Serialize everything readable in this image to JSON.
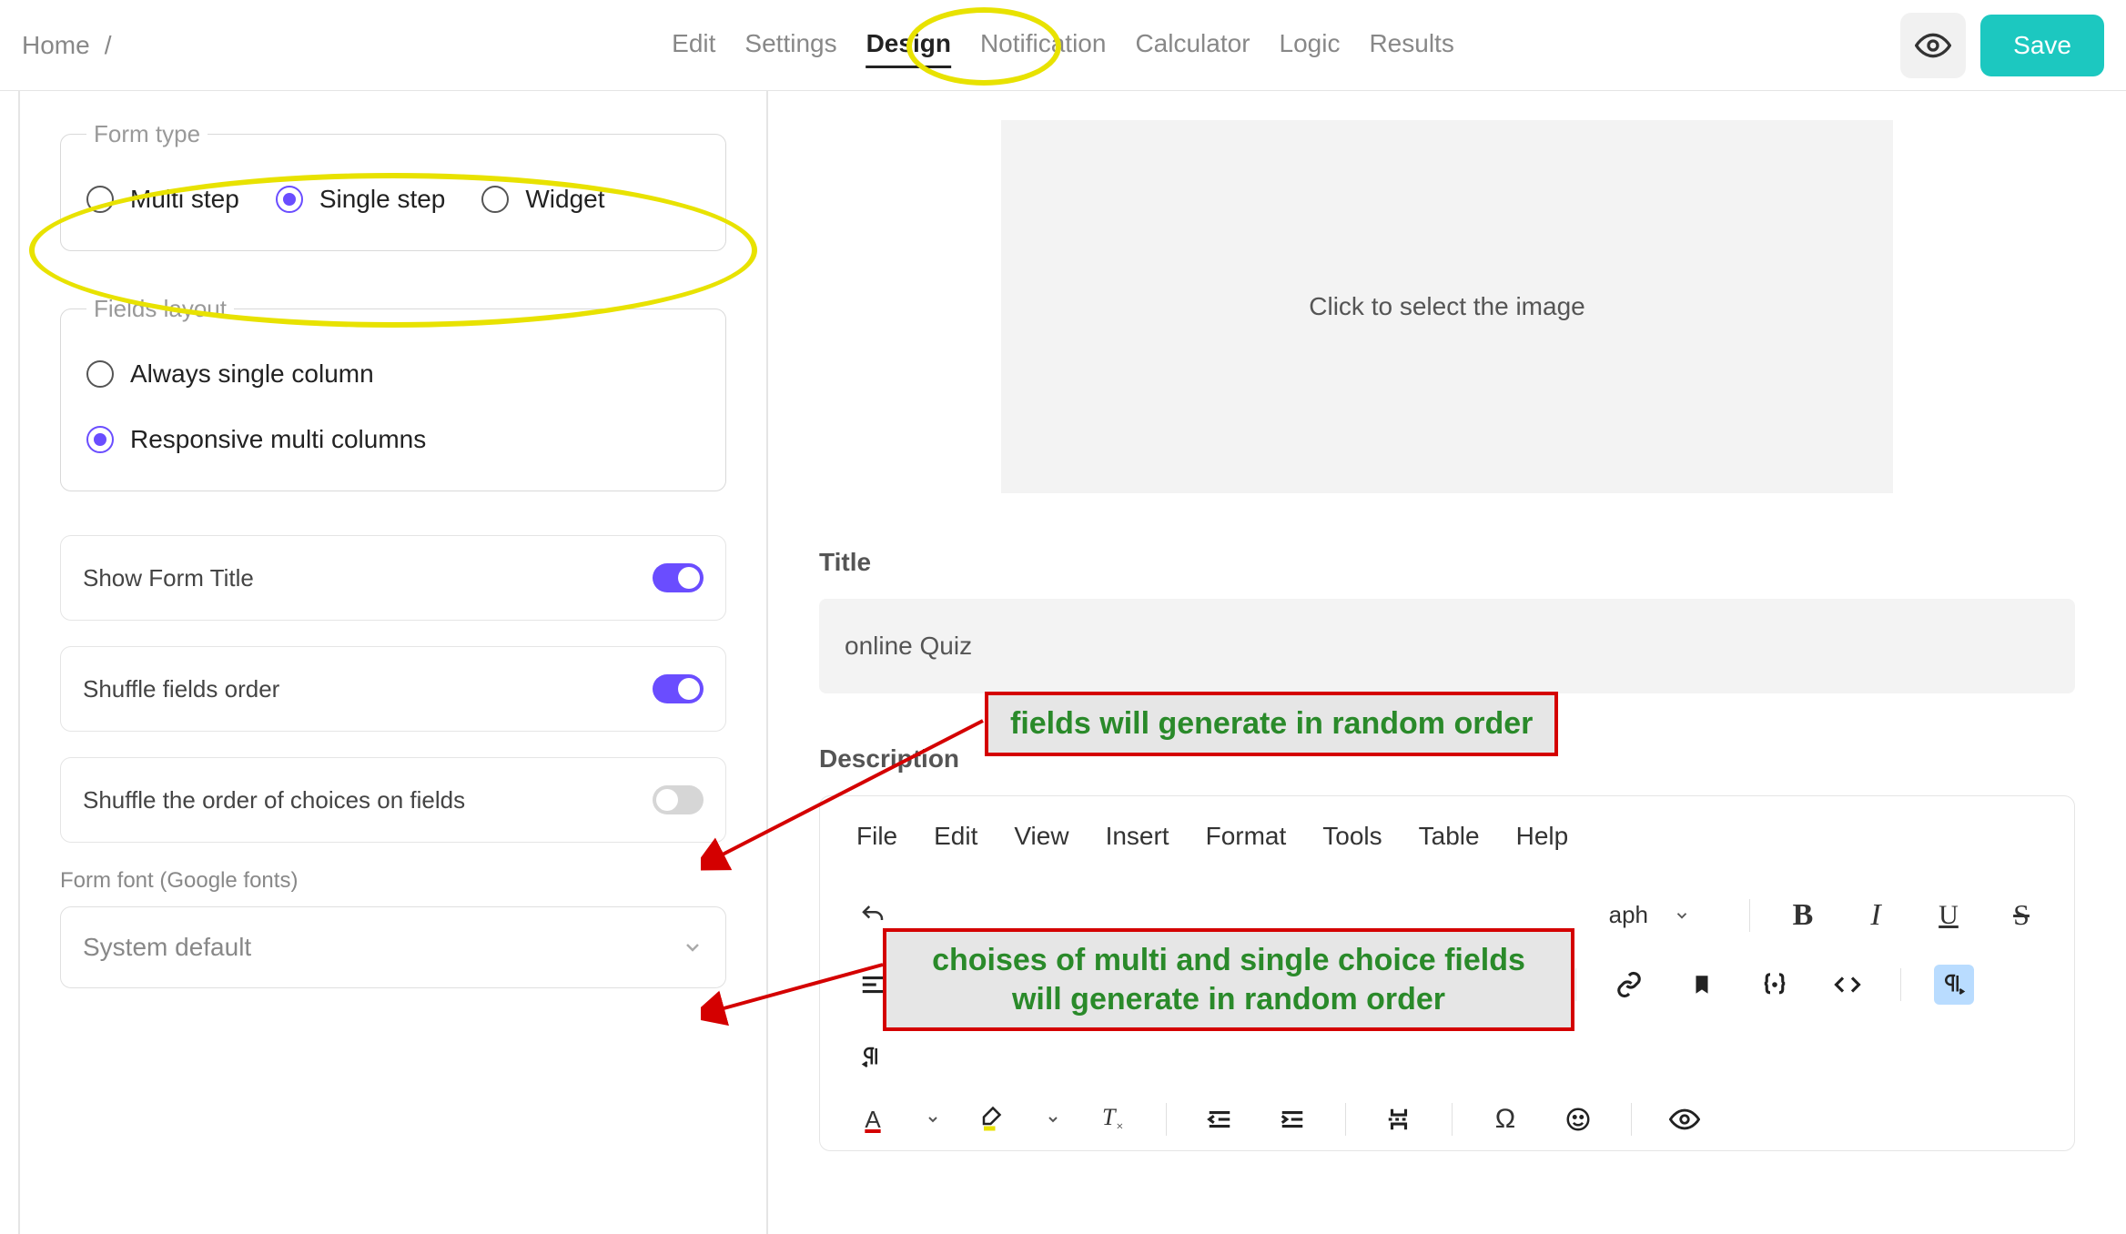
{
  "breadcrumb": {
    "home": "Home"
  },
  "tabs": [
    "Edit",
    "Settings",
    "Design",
    "Notification",
    "Calculator",
    "Logic",
    "Results"
  ],
  "active_tab": "Design",
  "save_label": "Save",
  "form_type": {
    "legend": "Form type",
    "options": [
      "Multi step",
      "Single step",
      "Widget"
    ],
    "selected": "Single step"
  },
  "fields_layout": {
    "legend": "Fields layout",
    "options": [
      "Always single column",
      "Responsive multi columns"
    ],
    "selected": "Responsive multi columns"
  },
  "toggles": {
    "show_title": {
      "label": "Show Form Title",
      "on": true
    },
    "shuffle_fields": {
      "label": "Shuffle fields order",
      "on": true
    },
    "shuffle_choices": {
      "label": "Shuffle the order of choices on fields",
      "on": false
    }
  },
  "font_section": {
    "label": "Form font (Google fonts)",
    "value": "System default"
  },
  "image_drop": "Click to select the image",
  "title_section": {
    "label": "Title",
    "value": "online Quiz"
  },
  "desc_section": {
    "label": "Description"
  },
  "editor": {
    "menus": [
      "File",
      "Edit",
      "View",
      "Insert",
      "Format",
      "Tools",
      "Table",
      "Help"
    ],
    "block_select": "aph"
  },
  "annotations": {
    "c1": "fields will generate in random order",
    "c2": "choises of multi and single choice fields will generate in random order"
  }
}
